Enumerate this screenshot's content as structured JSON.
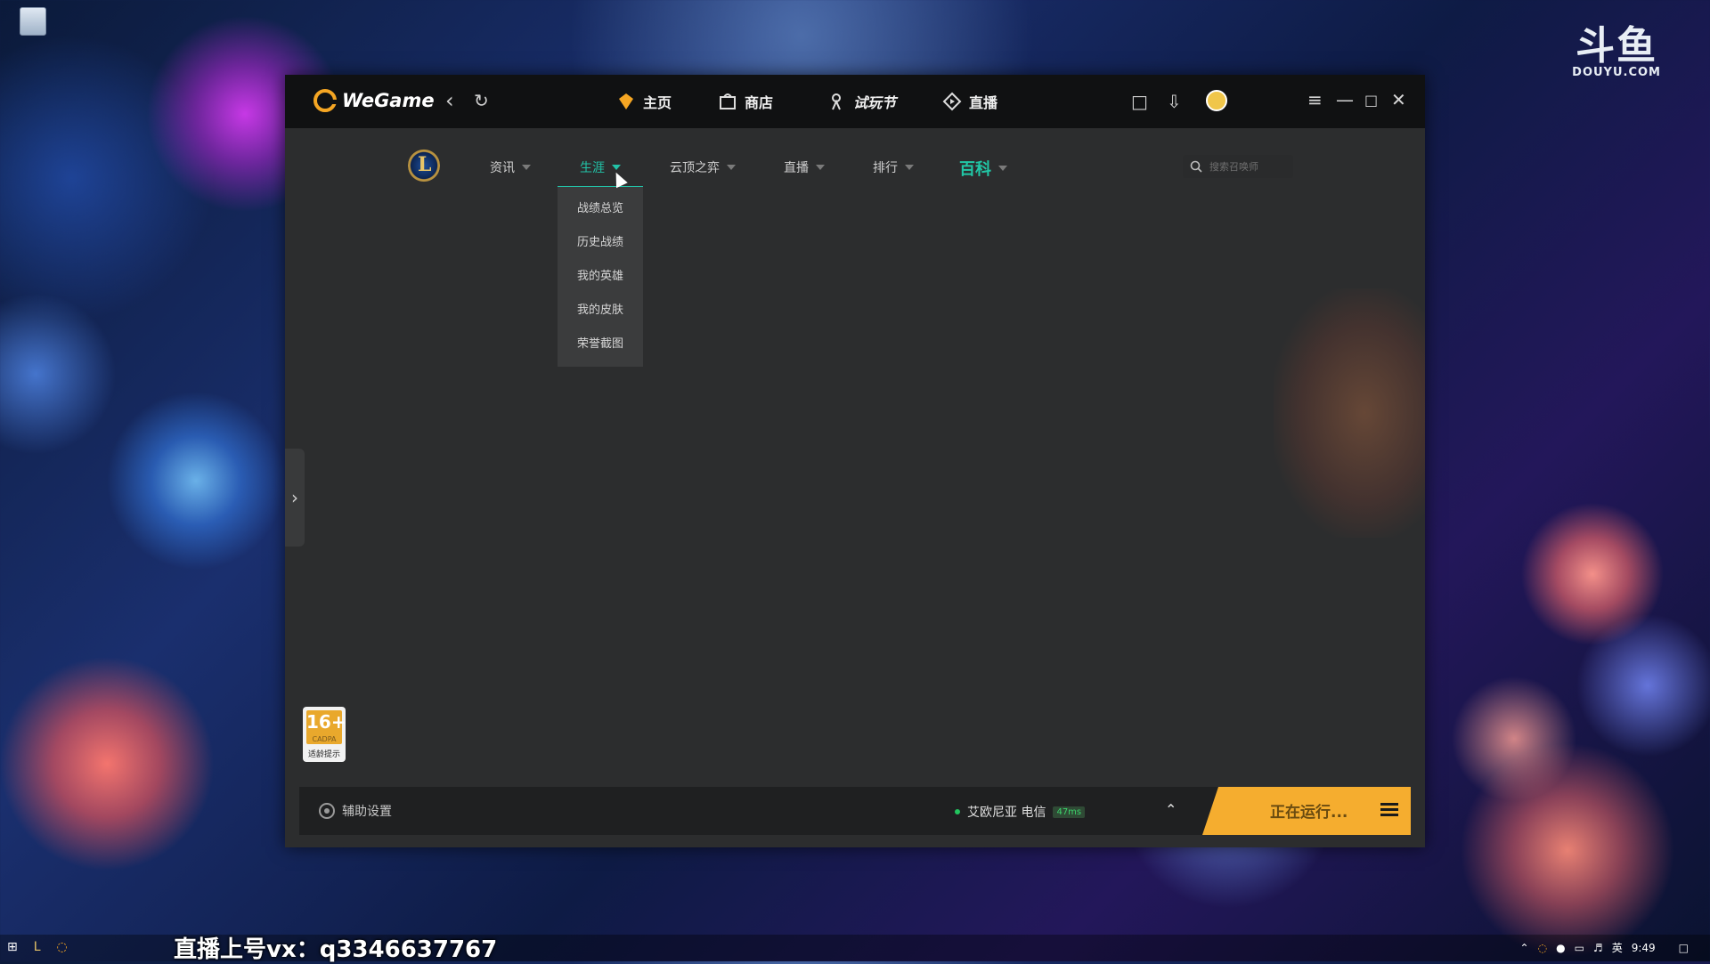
{
  "desktop": {
    "watermark_main": "斗鱼",
    "watermark_sub": "DOUYU.COM",
    "overlay_text": "直播上号vx：q3346637767"
  },
  "titlebar": {
    "brand": "WeGame",
    "nav": [
      {
        "label": "主页",
        "icon": "home-icon"
      },
      {
        "label": "商店",
        "icon": "shop-bag-icon"
      },
      {
        "label": "试玩节",
        "icon": "trial-festival-icon"
      },
      {
        "label": "直播",
        "icon": "live-icon"
      }
    ]
  },
  "game_nav": {
    "items": [
      {
        "label": "资讯"
      },
      {
        "label": "生涯"
      },
      {
        "label": "云顶之弈"
      },
      {
        "label": "直播"
      },
      {
        "label": "排行"
      },
      {
        "label": "百科"
      }
    ],
    "active": "生涯",
    "search_placeholder": "搜索召唤师"
  },
  "dropdown": {
    "items": [
      "战绩总览",
      "历史战绩",
      "我的英雄",
      "我的皮肤",
      "荣誉截图"
    ]
  },
  "age_rating": {
    "rating": "16+",
    "org": "CADPA",
    "label": "适龄提示"
  },
  "bottom_bar": {
    "assist_label": "辅助设置",
    "server": "艾欧尼亚 电信",
    "ping": "47ms",
    "run_label": "正在运行..."
  },
  "taskbar": {
    "ime": "英",
    "time": "9:49"
  },
  "colors": {
    "accent": "#22c3a8",
    "run_button": "#f5ad2f",
    "brand": "#f5a623"
  }
}
